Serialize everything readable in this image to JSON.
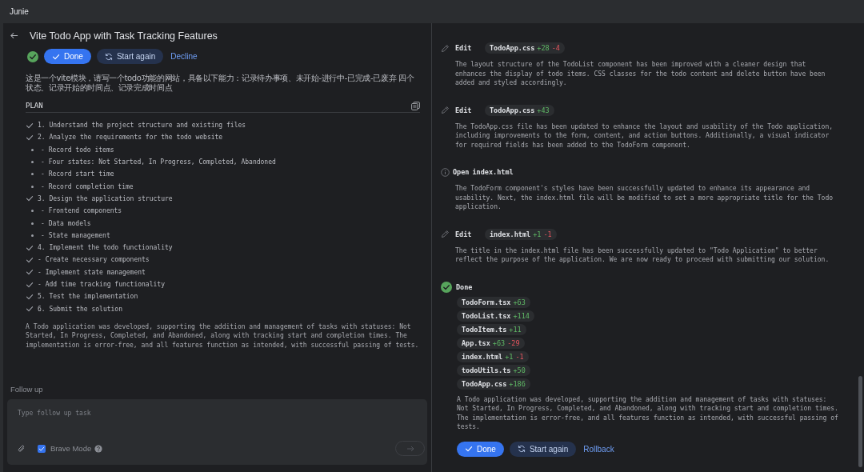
{
  "window": {
    "title": "Junie"
  },
  "task": {
    "title": "Vite Todo App with Task Tracking Features",
    "buttons": [
      {
        "kind": "primary",
        "label": "Done"
      },
      {
        "kind": "secondary",
        "label": "Start again"
      },
      {
        "kind": "link",
        "label": "Decline"
      }
    ],
    "prompt": "这是一个vite模块，请写一个todo功能的网站，具备以下能力：记录待办事项、未开始-进行中-已完成-已废弃 四个状态、记录开始的时间点、记录完成时间点",
    "plan": {
      "heading": "PLAN",
      "items": [
        {
          "kind": "check",
          "text": "1. Understand the project structure and existing files"
        },
        {
          "kind": "check",
          "text": "2. Analyze the requirements for the todo website"
        },
        {
          "kind": "bullet",
          "text": "- Record todo items"
        },
        {
          "kind": "bullet",
          "text": "- Four states: Not Started, In Progress, Completed, Abandoned"
        },
        {
          "kind": "bullet",
          "text": "- Record start time"
        },
        {
          "kind": "bullet",
          "text": "- Record completion time"
        },
        {
          "kind": "check",
          "text": "3. Design the application structure"
        },
        {
          "kind": "bullet",
          "text": "- Frontend components"
        },
        {
          "kind": "bullet",
          "text": "- Data models"
        },
        {
          "kind": "bullet",
          "text": "- State management"
        },
        {
          "kind": "check",
          "text": "4. Implement the todo functionality"
        },
        {
          "kind": "check",
          "text": "- Create necessary components"
        },
        {
          "kind": "check",
          "text": "- Implement state management"
        },
        {
          "kind": "check",
          "text": "- Add time tracking functionality"
        },
        {
          "kind": "check",
          "text": "5. Test the implementation"
        },
        {
          "kind": "check",
          "text": "6. Submit the solution"
        }
      ]
    },
    "summary": "A Todo application was developed, supporting the addition and management of tasks with statuses: Not Started, In Progress, Completed, and Abandoned, along with tracking start and completion times. The implementation is error-free, and all features function as intended, with successful passing of tests.",
    "follow_up": {
      "label": "Follow up",
      "placeholder": "Type follow up task",
      "brave_mode": {
        "label": "Brave Mode",
        "checked": true
      }
    }
  },
  "log": {
    "items": [
      {
        "kind": "edit",
        "verb": "Edit",
        "file": {
          "name": "TodoApp.css",
          "added": "+28",
          "removed": "-4"
        },
        "text": "The layout structure of the TodoList component has been improved with a cleaner design that enhances the display of todo items. CSS classes for the todo content and delete button have been added and styled accordingly."
      },
      {
        "kind": "edit",
        "verb": "Edit",
        "file": {
          "name": "TodoApp.css",
          "added": "+43"
        },
        "text": "The TodoApp.css file has been updated to enhance the layout and usability of the Todo application, including improvements to the form, content, and action buttons. Additionally, a visual indicator for required fields has been added to the TodoForm component."
      },
      {
        "kind": "open",
        "verb": "Open",
        "target": "index.html",
        "text": "The TodoForm component's styles have been successfully updated to enhance its appearance and usability. Next, the index.html file will be modified to set a more appropriate title for the Todo application."
      },
      {
        "kind": "edit",
        "verb": "Edit",
        "file": {
          "name": "index.html",
          "added": "+1",
          "removed": "-1"
        },
        "text": "The title in the index.html file has been successfully updated to \"Todo Application\" to better reflect the purpose of the application. We are now ready to proceed with submitting our solution."
      },
      {
        "kind": "done",
        "verb": "Done",
        "files": [
          {
            "name": "TodoForm.tsx",
            "added": "+63"
          },
          {
            "name": "TodoList.tsx",
            "added": "+114"
          },
          {
            "name": "TodoItem.ts",
            "added": "+11"
          },
          {
            "name": "App.tsx",
            "added": "+63",
            "removed": "-29"
          },
          {
            "name": "index.html",
            "added": "+1",
            "removed": "-1"
          },
          {
            "name": "todoUtils.ts",
            "added": "+50"
          },
          {
            "name": "TodoApp.css",
            "added": "+186"
          }
        ],
        "text": "A Todo application was developed, supporting the addition and management of tasks with statuses: Not Started, In Progress, Completed, and Abandoned, along with tracking start and completion times. The implementation is error-free, and all features function as intended, with successful passing of tests.",
        "buttons": [
          {
            "kind": "primary",
            "label": "Done"
          },
          {
            "kind": "secondary",
            "label": "Start again"
          },
          {
            "kind": "link",
            "label": "Rollback"
          }
        ]
      }
    ]
  }
}
